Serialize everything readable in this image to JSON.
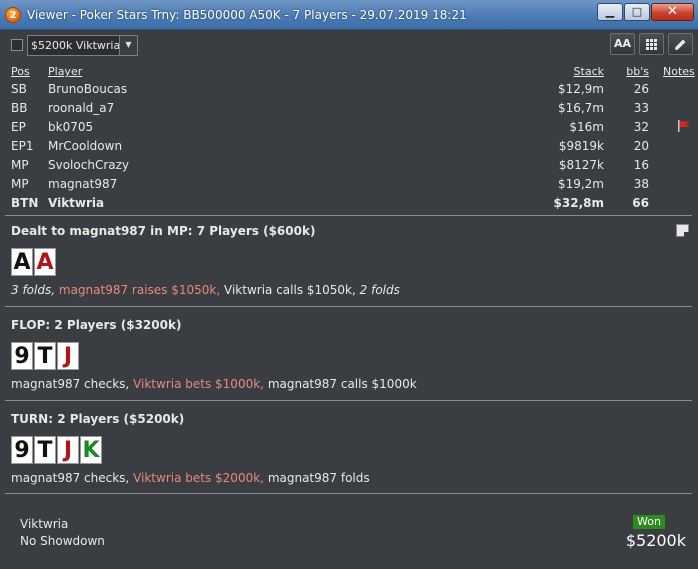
{
  "window": {
    "app_icon_glyph": "2",
    "title": "Viewer - Poker Stars Trny: BB500000 A50K - 7 Players - 29.07.2019 18:21",
    "minimize_glyph": "▁",
    "maximize_glyph": "□",
    "close_glyph": "✕"
  },
  "toolbar": {
    "hero_select_value": "$5200k Viktwria",
    "font_button_label": "AA",
    "grid_icon": "grid-icon",
    "edit_icon": "pencil-icon"
  },
  "players_table": {
    "headers": {
      "pos": "Pos",
      "player": "Player",
      "stack": "Stack",
      "bbs": "bb's",
      "notes": "Notes"
    },
    "rows": [
      {
        "pos": "SB",
        "name": "BrunoBoucas",
        "stack": "$12,9m",
        "bbs": "26"
      },
      {
        "pos": "BB",
        "name": "roonald_a7",
        "stack": "$16,7m",
        "bbs": "33"
      },
      {
        "pos": "EP",
        "name": "bk0705",
        "stack": "$16m",
        "bbs": "32"
      },
      {
        "pos": "EP1",
        "name": "MrCooldown",
        "stack": "$9819k",
        "bbs": "20"
      },
      {
        "pos": "MP",
        "name": "SvolochCrazy",
        "stack": "$8127k",
        "bbs": "16"
      },
      {
        "pos": "MP",
        "name": "magnat987",
        "stack": "$19,2m",
        "bbs": "38"
      },
      {
        "pos": "BTN",
        "name": "Viktwria",
        "stack": "$32,8m",
        "bbs": "66"
      }
    ],
    "flag_color": "#d9261c"
  },
  "preflop": {
    "title": "Dealt to magnat987 in MP: 7 Players ($600k)",
    "cards": [
      {
        "rank": "A",
        "color": "black"
      },
      {
        "rank": "A",
        "color": "red"
      }
    ],
    "action_1": "3 folds,",
    "action_2": "magnat987 raises $1050k,",
    "action_3": "Viktwria calls $1050k,",
    "action_4": "2 folds"
  },
  "flop": {
    "title": "FLOP: 2 Players ($3200k)",
    "cards": [
      {
        "rank": "9",
        "color": "black"
      },
      {
        "rank": "T",
        "color": "black"
      },
      {
        "rank": "J",
        "color": "red"
      }
    ],
    "action_1": "magnat987 checks,",
    "action_2": "Viktwria bets $1000k,",
    "action_3": "magnat987 calls $1000k"
  },
  "turn": {
    "title": "TURN: 2 Players ($5200k)",
    "cards": [
      {
        "rank": "9",
        "color": "black"
      },
      {
        "rank": "T",
        "color": "black"
      },
      {
        "rank": "J",
        "color": "red"
      },
      {
        "rank": "K",
        "color": "green"
      }
    ],
    "action_1": "magnat987 checks,",
    "action_2": "Viktwria bets $2000k,",
    "action_3": "magnat987 folds"
  },
  "result": {
    "winner": "Viktwria",
    "showdown": "No Showdown",
    "badge": "Won",
    "amount": "$5200k"
  },
  "colors": {
    "background": "#3a3d42",
    "highlight_action": "#e9897a",
    "won_badge": "#2e8b1e",
    "titlebar": "#4a79b3"
  }
}
